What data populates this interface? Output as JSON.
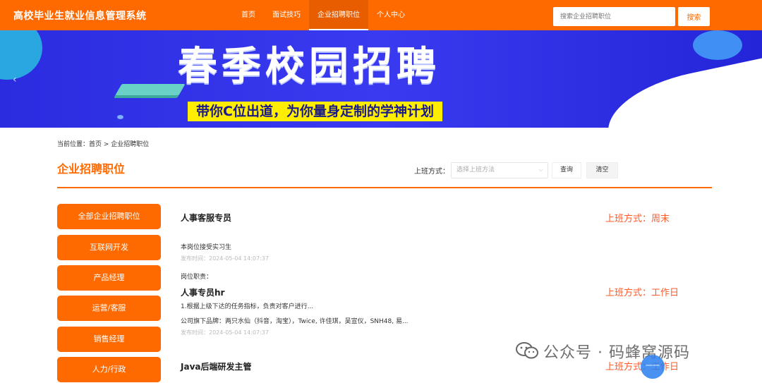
{
  "header": {
    "brand": "高校毕业生就业信息管理系统",
    "nav": [
      "首页",
      "面试技巧",
      "企业招聘职位",
      "个人中心"
    ],
    "active_nav": "企业招聘职位",
    "search_placeholder": "搜索企业招聘职位",
    "search_button": "搜索"
  },
  "banner": {
    "title": "春季校园招聘",
    "subtitle": "带你C位出道，为你量身定制的学神计划"
  },
  "breadcrumb": "当前位置：首页 > 企业招聘职位",
  "page_title": "企业招聘职位",
  "filter": {
    "label": "上班方式：",
    "select_placeholder": "选择上班方法",
    "query_button": "查询",
    "clear_button": "清空"
  },
  "categories": [
    "全部企业招聘职位",
    "互联网开发",
    "产品经理",
    "运营/客服",
    "销售经理",
    "人力/行政"
  ],
  "jobs": [
    {
      "title": "人事客服专员",
      "mode": "上班方式：周末",
      "desc": "本岗位接受实习生",
      "time": "发布时间：2024-05-04 14:07:37"
    },
    {
      "extra": "岗位职责：",
      "title": "人事专员hr",
      "mode": "上班方式：工作日",
      "desc": "1.根据上级下达的任务指标，负责对客户进行...",
      "desc2": "公司旗下品牌：两只水仙（抖音，淘宝），Twice, 许佳琪，吴宣仪，SNH48, 易...",
      "time": "发布时间：2024-05-04 14:07:37"
    },
    {
      "title": "Java后端研发主管",
      "mode": "上班方式：工作日"
    }
  ],
  "watermark": "公众号 · 码蜂窝源码",
  "float_button": "一一"
}
